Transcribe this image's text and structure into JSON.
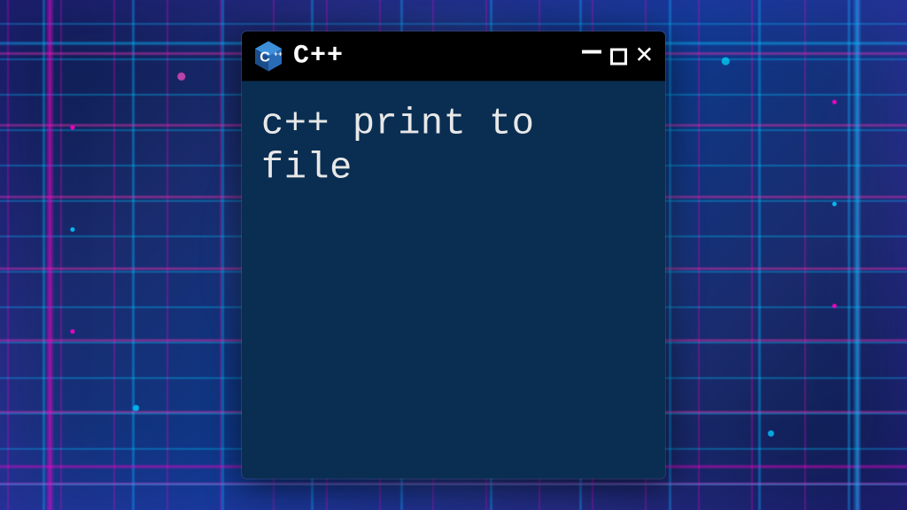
{
  "window": {
    "title": "C++",
    "icon_name": "cpp-logo-icon",
    "body_text": "c++ print to file"
  },
  "colors": {
    "titlebar_bg": "#000000",
    "window_bg": "#0a2e52",
    "text": "#e8e8e8"
  }
}
